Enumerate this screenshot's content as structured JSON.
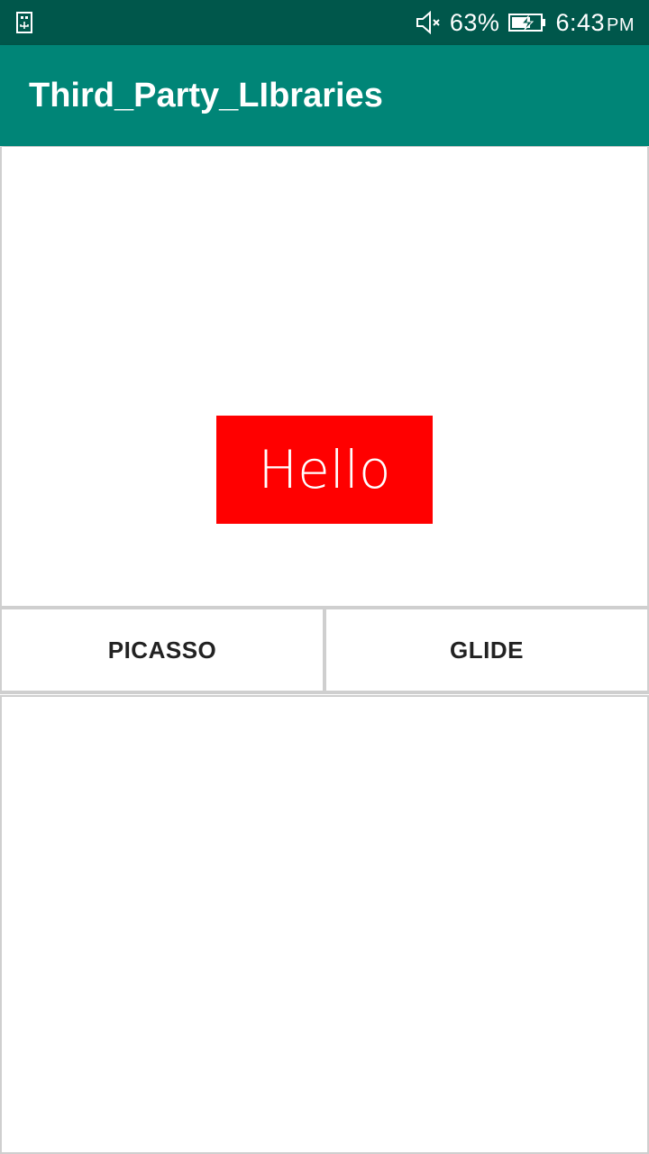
{
  "status_bar": {
    "battery_percent": "63%",
    "time": "6:43",
    "ampm": "PM",
    "icons": [
      "usb-icon",
      "mute-icon",
      "battery-charging-icon"
    ]
  },
  "app_bar": {
    "title": "Third_Party_LIbraries",
    "color": "#008577"
  },
  "main": {
    "hello_text": "Hello",
    "hello_color": "#ff0000",
    "buttons": [
      {
        "label": "PICASSO"
      },
      {
        "label": "GLIDE"
      }
    ]
  }
}
